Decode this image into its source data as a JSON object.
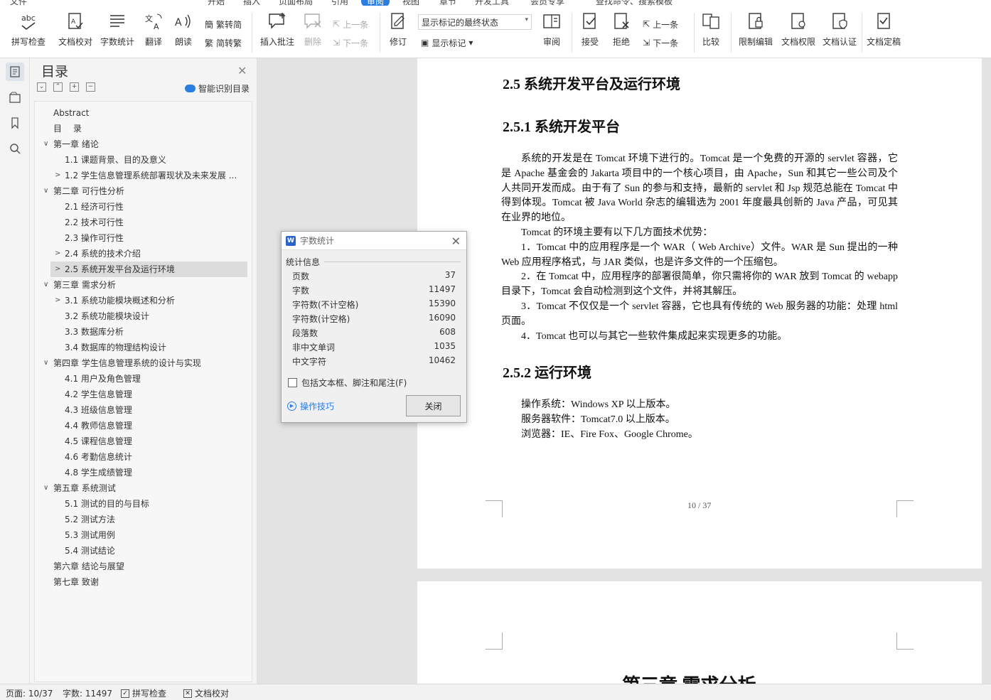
{
  "menu": {
    "items": [
      {
        "label": "文件",
        "active": false
      },
      {
        "label": "开始",
        "active": false
      },
      {
        "label": "插入",
        "active": false
      },
      {
        "label": "页面布局",
        "active": false
      },
      {
        "label": "引用",
        "active": false
      },
      {
        "label": "审阅",
        "active": true
      },
      {
        "label": "视图",
        "active": false
      },
      {
        "label": "章节",
        "active": false
      },
      {
        "label": "开发工具",
        "active": false
      },
      {
        "label": "会员专享",
        "active": false
      },
      {
        "label": "查找命令、搜索模板",
        "active": false
      }
    ]
  },
  "ribbon": {
    "spell_check": "拼写检查",
    "doc_proof": "文档校对",
    "word_count": "字数统计",
    "translate": "翻译",
    "read_aloud": "朗读",
    "to_traditional": "繁转简",
    "to_simplified": "简转繁",
    "insert_comment": "插入批注",
    "delete": "删除",
    "prev_comment": "上一条",
    "next_comment": "下一条",
    "track_changes": "修订",
    "markup_state": "显示标记的最终状态",
    "show_markup": "显示标记",
    "review": "审阅",
    "accept": "接受",
    "reject": "拒绝",
    "prev_change": "上一条",
    "next_change": "下一条",
    "compare": "比较",
    "restrict_edit": "限制编辑",
    "doc_permission": "文档权限",
    "doc_auth": "文档认证",
    "doc_finalize": "文档定稿"
  },
  "toc": {
    "title": "目录",
    "smart_label": "智能识别目录",
    "items": [
      {
        "label": "Abstract",
        "level": 0,
        "arrow": "",
        "selected": false
      },
      {
        "label": "目　 录",
        "level": 0,
        "arrow": "",
        "selected": false
      },
      {
        "label": "第一章  绪论",
        "level": 0,
        "arrow": "∨",
        "selected": false
      },
      {
        "label": "1.1  课题背景、目的及意义",
        "level": 1,
        "arrow": "",
        "selected": false
      },
      {
        "label": "1.2  学生信息管理系统部署现状及未来发展 ...",
        "level": 1,
        "arrow": ">",
        "selected": false
      },
      {
        "label": "第二章  可行性分析",
        "level": 0,
        "arrow": "∨",
        "selected": false
      },
      {
        "label": "2.1  经济可行性",
        "level": 1,
        "arrow": "",
        "selected": false
      },
      {
        "label": "2.2  技术可行性",
        "level": 1,
        "arrow": "",
        "selected": false
      },
      {
        "label": "2.3  操作可行性",
        "level": 1,
        "arrow": "",
        "selected": false
      },
      {
        "label": "2.4  系统的技术介绍",
        "level": 1,
        "arrow": ">",
        "selected": false
      },
      {
        "label": "2.5  系统开发平台及运行环境",
        "level": 1,
        "arrow": ">",
        "selected": true
      },
      {
        "label": "第三章  需求分析",
        "level": 0,
        "arrow": "∨",
        "selected": false
      },
      {
        "label": "3.1  系统功能模块概述和分析",
        "level": 1,
        "arrow": ">",
        "selected": false
      },
      {
        "label": "3.2  系统功能模块设计",
        "level": 1,
        "arrow": "",
        "selected": false
      },
      {
        "label": "3.3  数据库分析",
        "level": 1,
        "arrow": "",
        "selected": false
      },
      {
        "label": "3.4  数据库的物理结构设计",
        "level": 1,
        "arrow": "",
        "selected": false
      },
      {
        "label": "第四章  学生信息管理系统的设计与实现",
        "level": 0,
        "arrow": "∨",
        "selected": false
      },
      {
        "label": "4.1    用户及角色管理",
        "level": 1,
        "arrow": "",
        "selected": false
      },
      {
        "label": "4.2    学生信息管理",
        "level": 1,
        "arrow": "",
        "selected": false
      },
      {
        "label": "4.3    班级信息管理",
        "level": 1,
        "arrow": "",
        "selected": false
      },
      {
        "label": "4.4    教师信息管理",
        "level": 1,
        "arrow": "",
        "selected": false
      },
      {
        "label": "4.5    课程信息管理",
        "level": 1,
        "arrow": "",
        "selected": false
      },
      {
        "label": "4.6    考勤信息统计",
        "level": 1,
        "arrow": "",
        "selected": false
      },
      {
        "label": "4.8  学生成绩管理",
        "level": 1,
        "arrow": "",
        "selected": false
      },
      {
        "label": "第五章  系统测试",
        "level": 0,
        "arrow": "∨",
        "selected": false
      },
      {
        "label": "5.1  测试的目的与目标",
        "level": 1,
        "arrow": "",
        "selected": false
      },
      {
        "label": "5.2  测试方法",
        "level": 1,
        "arrow": "",
        "selected": false
      },
      {
        "label": "5.3  测试用例",
        "level": 1,
        "arrow": "",
        "selected": false
      },
      {
        "label": "5.4  测试结论",
        "level": 1,
        "arrow": "",
        "selected": false
      },
      {
        "label": "第六章  结论与展望",
        "level": 0,
        "arrow": "",
        "selected": false
      },
      {
        "label": "第七章  致谢",
        "level": 0,
        "arrow": "",
        "selected": false
      }
    ]
  },
  "document": {
    "h2": "2.5  系统开发平台及运行环境",
    "h3_platform": "2.5.1  系统开发平台",
    "platform_paragraphs": [
      "系统的开发是在 Tomcat 环境下进行的。Tomcat 是一个免费的开源的 servlet 容器，它是 Apache 基金会的 Jakarta 项目中的一个核心项目，由 Apache，Sun 和其它一些公司及个人共同开发而成。由于有了 Sun 的参与和支持，最新的 servlet 和 Jsp 规范总能在 Tomcat 中得到体现。Tomcat 被 Java World 杂志的编辑选为 2001 年度最具创新的 Java 产品，可见其在业界的地位。",
      "Tomcat 的环境主要有以下几方面技术优势：",
      "1．Tomcat 中的应用程序是一个 WAR（ Web Archive）文件。WAR 是 Sun 提出的一种 Web 应用程序格式，与 JAR 类似，也是许多文件的一个压缩包。",
      "2．在 Tomcat 中，应用程序的部署很简单，你只需将你的 WAR 放到 Tomcat 的 webapp 目录下，Tomcat 会自动检测到这个文件，并将其解压。",
      "3．Tomcat 不仅仅是一个 servlet 容器，它也具有传统的 Web 服务器的功能：处理 html 页面。",
      "4．Tomcat 也可以与其它一些软件集成起来实现更多的功能。"
    ],
    "h3_runtime": "2.5.2  运行环境",
    "runtime_lines": [
      "操作系统：Windows XP 以上版本。",
      "服务器软件：Tomcat7.0 以上版本。",
      "浏览器：IE、Fire Fox、Google Chrome。"
    ],
    "page_number": "10 / 37",
    "next_chapter": "第三章  需求分析"
  },
  "dialog": {
    "title": "字数统计",
    "group": "统计信息",
    "stats": [
      {
        "label": "页数",
        "value": "37"
      },
      {
        "label": "字数",
        "value": "11497"
      },
      {
        "label": "字符数(不计空格)",
        "value": "15390"
      },
      {
        "label": "字符数(计空格)",
        "value": "16090"
      },
      {
        "label": "段落数",
        "value": "608"
      },
      {
        "label": "非中文单词",
        "value": "1035"
      },
      {
        "label": "中文字符",
        "value": "10462"
      }
    ],
    "checkbox_label": "包括文本框、脚注和尾注(F)",
    "tips_label": "操作技巧",
    "close_label": "关闭"
  },
  "status": {
    "page": "页面: 10/37",
    "words": "字数: 11497",
    "spell": "拼写检查",
    "proof": "文档校对"
  },
  "colors": {
    "accent": "#2a7de1",
    "selected_toc": "#dcdcdc",
    "doc_bg": "#e3e3e3"
  }
}
